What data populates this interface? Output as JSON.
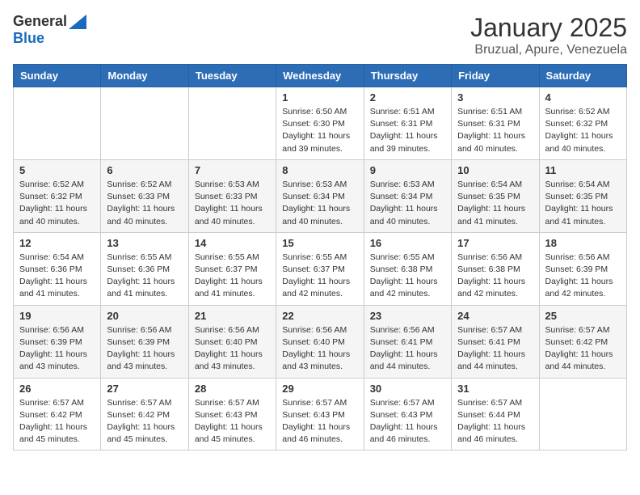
{
  "header": {
    "logo_line1": "General",
    "logo_line2": "Blue",
    "month_title": "January 2025",
    "location": "Bruzual, Apure, Venezuela"
  },
  "days_of_week": [
    "Sunday",
    "Monday",
    "Tuesday",
    "Wednesday",
    "Thursday",
    "Friday",
    "Saturday"
  ],
  "weeks": [
    [
      {
        "day": "",
        "info": ""
      },
      {
        "day": "",
        "info": ""
      },
      {
        "day": "",
        "info": ""
      },
      {
        "day": "1",
        "info": "Sunrise: 6:50 AM\nSunset: 6:30 PM\nDaylight: 11 hours and 39 minutes."
      },
      {
        "day": "2",
        "info": "Sunrise: 6:51 AM\nSunset: 6:31 PM\nDaylight: 11 hours and 39 minutes."
      },
      {
        "day": "3",
        "info": "Sunrise: 6:51 AM\nSunset: 6:31 PM\nDaylight: 11 hours and 40 minutes."
      },
      {
        "day": "4",
        "info": "Sunrise: 6:52 AM\nSunset: 6:32 PM\nDaylight: 11 hours and 40 minutes."
      }
    ],
    [
      {
        "day": "5",
        "info": "Sunrise: 6:52 AM\nSunset: 6:32 PM\nDaylight: 11 hours and 40 minutes."
      },
      {
        "day": "6",
        "info": "Sunrise: 6:52 AM\nSunset: 6:33 PM\nDaylight: 11 hours and 40 minutes."
      },
      {
        "day": "7",
        "info": "Sunrise: 6:53 AM\nSunset: 6:33 PM\nDaylight: 11 hours and 40 minutes."
      },
      {
        "day": "8",
        "info": "Sunrise: 6:53 AM\nSunset: 6:34 PM\nDaylight: 11 hours and 40 minutes."
      },
      {
        "day": "9",
        "info": "Sunrise: 6:53 AM\nSunset: 6:34 PM\nDaylight: 11 hours and 40 minutes."
      },
      {
        "day": "10",
        "info": "Sunrise: 6:54 AM\nSunset: 6:35 PM\nDaylight: 11 hours and 41 minutes."
      },
      {
        "day": "11",
        "info": "Sunrise: 6:54 AM\nSunset: 6:35 PM\nDaylight: 11 hours and 41 minutes."
      }
    ],
    [
      {
        "day": "12",
        "info": "Sunrise: 6:54 AM\nSunset: 6:36 PM\nDaylight: 11 hours and 41 minutes."
      },
      {
        "day": "13",
        "info": "Sunrise: 6:55 AM\nSunset: 6:36 PM\nDaylight: 11 hours and 41 minutes."
      },
      {
        "day": "14",
        "info": "Sunrise: 6:55 AM\nSunset: 6:37 PM\nDaylight: 11 hours and 41 minutes."
      },
      {
        "day": "15",
        "info": "Sunrise: 6:55 AM\nSunset: 6:37 PM\nDaylight: 11 hours and 42 minutes."
      },
      {
        "day": "16",
        "info": "Sunrise: 6:55 AM\nSunset: 6:38 PM\nDaylight: 11 hours and 42 minutes."
      },
      {
        "day": "17",
        "info": "Sunrise: 6:56 AM\nSunset: 6:38 PM\nDaylight: 11 hours and 42 minutes."
      },
      {
        "day": "18",
        "info": "Sunrise: 6:56 AM\nSunset: 6:39 PM\nDaylight: 11 hours and 42 minutes."
      }
    ],
    [
      {
        "day": "19",
        "info": "Sunrise: 6:56 AM\nSunset: 6:39 PM\nDaylight: 11 hours and 43 minutes."
      },
      {
        "day": "20",
        "info": "Sunrise: 6:56 AM\nSunset: 6:39 PM\nDaylight: 11 hours and 43 minutes."
      },
      {
        "day": "21",
        "info": "Sunrise: 6:56 AM\nSunset: 6:40 PM\nDaylight: 11 hours and 43 minutes."
      },
      {
        "day": "22",
        "info": "Sunrise: 6:56 AM\nSunset: 6:40 PM\nDaylight: 11 hours and 43 minutes."
      },
      {
        "day": "23",
        "info": "Sunrise: 6:56 AM\nSunset: 6:41 PM\nDaylight: 11 hours and 44 minutes."
      },
      {
        "day": "24",
        "info": "Sunrise: 6:57 AM\nSunset: 6:41 PM\nDaylight: 11 hours and 44 minutes."
      },
      {
        "day": "25",
        "info": "Sunrise: 6:57 AM\nSunset: 6:42 PM\nDaylight: 11 hours and 44 minutes."
      }
    ],
    [
      {
        "day": "26",
        "info": "Sunrise: 6:57 AM\nSunset: 6:42 PM\nDaylight: 11 hours and 45 minutes."
      },
      {
        "day": "27",
        "info": "Sunrise: 6:57 AM\nSunset: 6:42 PM\nDaylight: 11 hours and 45 minutes."
      },
      {
        "day": "28",
        "info": "Sunrise: 6:57 AM\nSunset: 6:43 PM\nDaylight: 11 hours and 45 minutes."
      },
      {
        "day": "29",
        "info": "Sunrise: 6:57 AM\nSunset: 6:43 PM\nDaylight: 11 hours and 46 minutes."
      },
      {
        "day": "30",
        "info": "Sunrise: 6:57 AM\nSunset: 6:43 PM\nDaylight: 11 hours and 46 minutes."
      },
      {
        "day": "31",
        "info": "Sunrise: 6:57 AM\nSunset: 6:44 PM\nDaylight: 11 hours and 46 minutes."
      },
      {
        "day": "",
        "info": ""
      }
    ]
  ]
}
